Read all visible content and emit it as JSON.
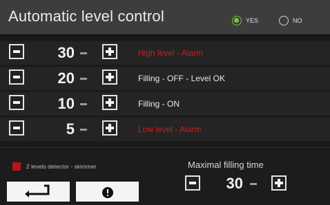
{
  "header": {
    "title": "Automatic level control",
    "options": [
      {
        "label": "YES",
        "selected": true
      },
      {
        "label": "NO",
        "selected": false
      }
    ]
  },
  "levels": [
    {
      "value": "30",
      "description": "High level - Alarm",
      "alarm": true
    },
    {
      "value": "20",
      "description": "Filling - OFF - Level OK",
      "alarm": false
    },
    {
      "value": "10",
      "description": "Filling - ON",
      "alarm": false
    },
    {
      "value": "5",
      "description": "Low level - Alarm",
      "alarm": true
    }
  ],
  "detector": {
    "label": "2 levels detector - skimmer",
    "checked": true
  },
  "max_filling": {
    "label": "Maximal filling time",
    "value": "30"
  },
  "nav": {
    "back_icon": "return-arrow-icon",
    "info_icon": "info-icon"
  },
  "colors": {
    "accent_green": "#72c63a",
    "alarm_red": "#d31b1b",
    "checkbox_red": "#b51616"
  }
}
